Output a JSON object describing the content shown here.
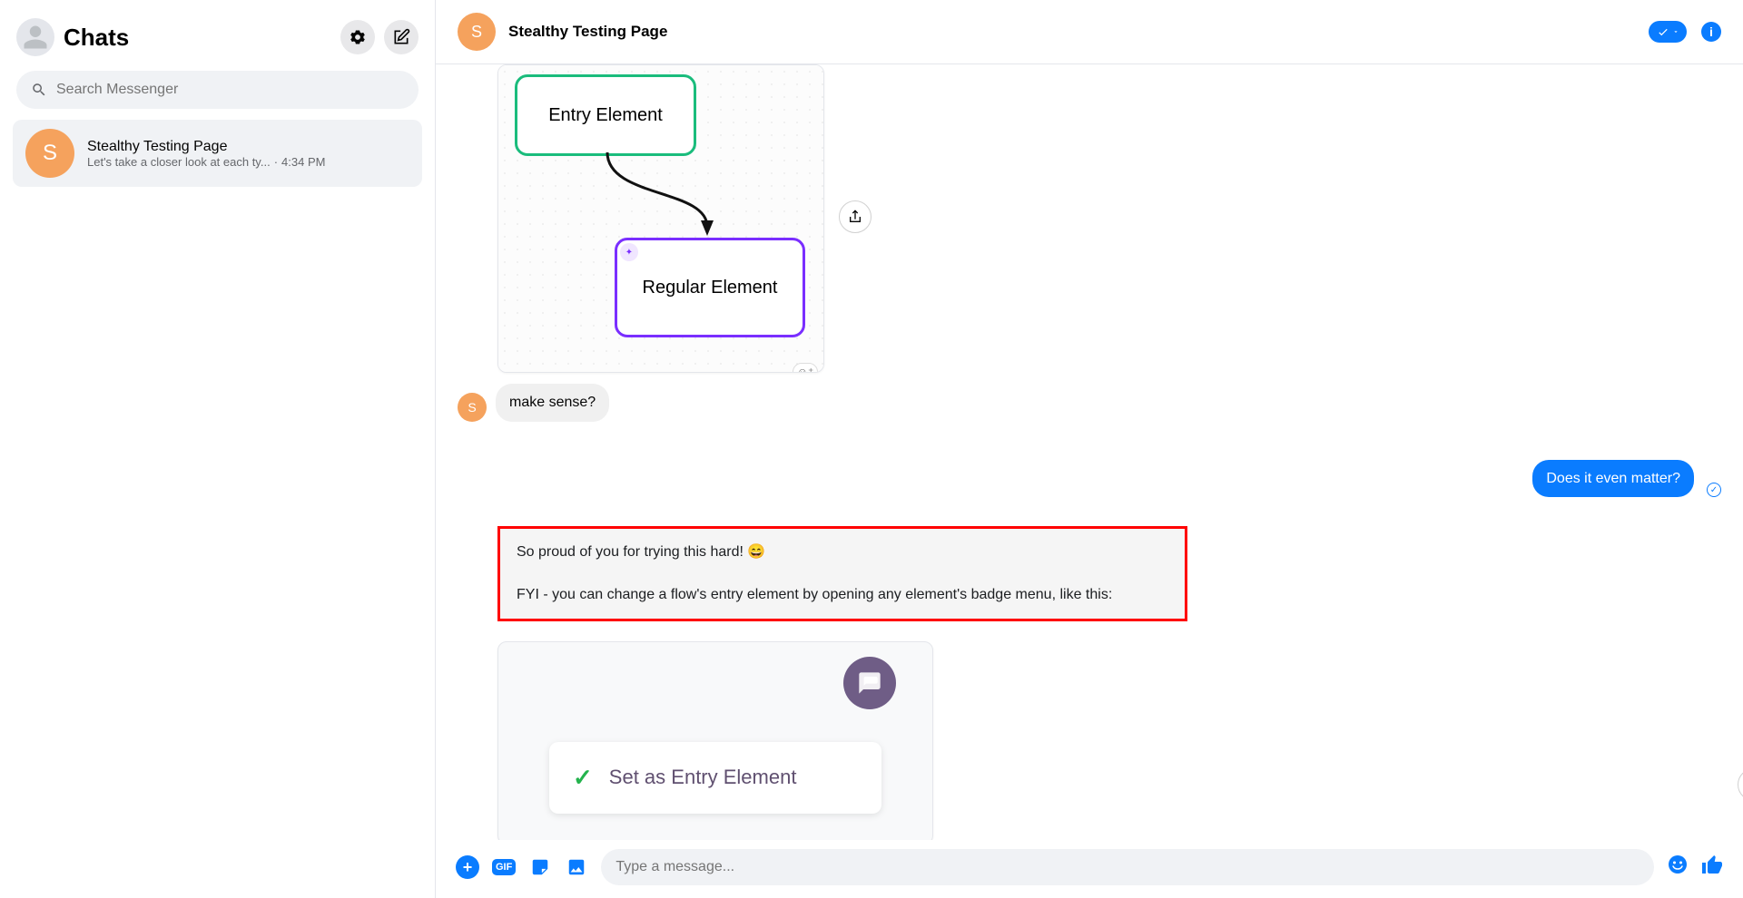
{
  "sidebar": {
    "title": "Chats",
    "search_placeholder": "Search Messenger",
    "conversations": [
      {
        "initial": "S",
        "name": "Stealthy Testing Page",
        "snippet": "Let's take a closer look at each ty...",
        "time": "4:34 PM"
      }
    ]
  },
  "header": {
    "initial": "S",
    "title": "Stealthy Testing Page"
  },
  "messages": {
    "attach1": {
      "entry_label": "Entry Element",
      "regular_label": "Regular Element"
    },
    "m1_text": "make sense?",
    "m1_initial": "S",
    "m2_text": "Does it even matter?",
    "red_p1": "So proud of you for trying this hard! 😄",
    "red_p2": "FYI - you can change a flow's entry element by opening any element's badge menu, like this:",
    "attach2": {
      "menu_label": "Set as Entry Element"
    }
  },
  "composer": {
    "placeholder": "Type a message...",
    "gif_label": "GIF"
  }
}
